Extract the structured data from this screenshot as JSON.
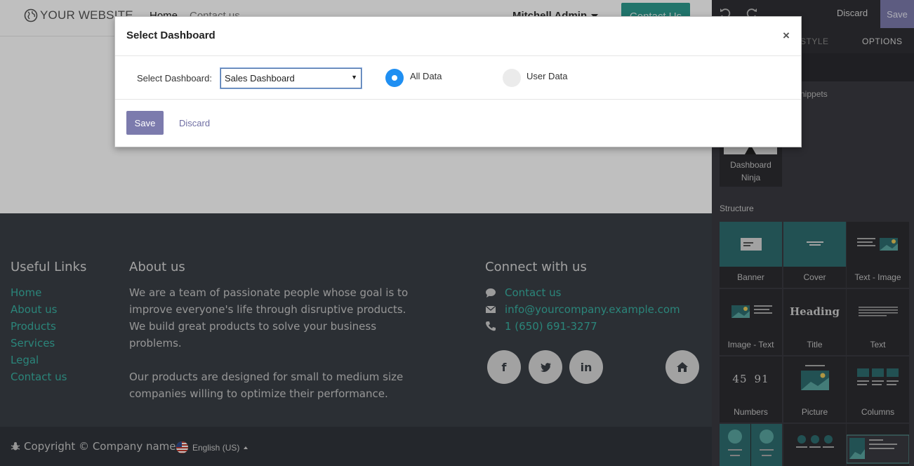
{
  "site": {
    "logo_text": "YOUR WEBSITE",
    "nav": [
      "Home",
      "Contact us"
    ],
    "user_name": "Mitchell Admin",
    "contact_button": "Contact Us"
  },
  "footer": {
    "useful_links": {
      "title": "Useful Links",
      "items": [
        "Home",
        "About us",
        "Products",
        "Services",
        "Legal",
        "Contact us"
      ]
    },
    "about": {
      "title": "About us",
      "p1": "We are a team of passionate people whose goal is to improve everyone's life through disruptive products. We build great products to solve your business problems.",
      "p2": "Our products are designed for small to medium size companies willing to optimize their performance."
    },
    "connect": {
      "title": "Connect with us",
      "contact": "Contact us",
      "email": "info@yourcompany.example.com",
      "phone": "1 (650) 691-3277"
    },
    "social": [
      "facebook-icon",
      "twitter-icon",
      "linkedin-icon",
      "home-icon"
    ],
    "copyright": "Copyright © Company name",
    "language": "English (US)"
  },
  "editor": {
    "discard": "Discard",
    "save": "Save",
    "tabs": [
      "STYLE",
      "OPTIONS"
    ],
    "snippets_label": "nippets",
    "dashboard_ninja": "Dashboard Ninja",
    "structure_label": "Structure",
    "snippets": [
      "Banner",
      "Cover",
      "Text - Image",
      "Image - Text",
      "Title",
      "Text",
      "Numbers",
      "Picture",
      "Columns"
    ],
    "heading_thumb": "Heading",
    "numbers_thumb": [
      "45",
      "91"
    ]
  },
  "modal": {
    "title": "Select Dashboard",
    "close": "×",
    "select_label": "Select Dashboard:",
    "selected_dashboard": "Sales Dashboard",
    "radio_all": "All Data",
    "radio_user": "User Data",
    "selected_radio": "All Data",
    "save": "Save",
    "discard": "Discard"
  },
  "colors": {
    "accent": "#7c7bad",
    "teal": "#2c9b8f",
    "radio_active": "#1f8ff2",
    "footer_bg": "#3a3f46"
  }
}
